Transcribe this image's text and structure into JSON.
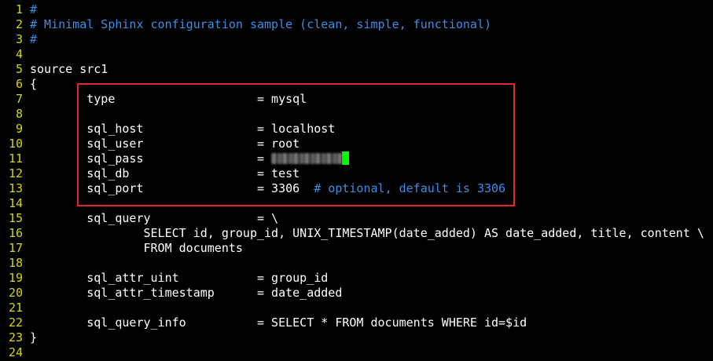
{
  "editor": {
    "lines": [
      {
        "n": "1",
        "text": "#",
        "comment": true
      },
      {
        "n": "2",
        "text": "# Minimal Sphinx configuration sample (clean, simple, functional)",
        "comment": true
      },
      {
        "n": "3",
        "text": "#",
        "comment": true
      },
      {
        "n": "4",
        "text": ""
      },
      {
        "n": "5",
        "text": "source src1"
      },
      {
        "n": "6",
        "text": "{"
      },
      {
        "n": "7",
        "text": "        type                    = mysql"
      },
      {
        "n": "8",
        "text": ""
      },
      {
        "n": "9",
        "text": "        sql_host                = localhost"
      },
      {
        "n": "10",
        "text": "        sql_user                = root"
      },
      {
        "n": "11",
        "text": "        sql_pass                = ",
        "masked": true
      },
      {
        "n": "12",
        "text": "        sql_db                  = test"
      },
      {
        "n": "13",
        "text": "        sql_port                = 3306",
        "trailing_comment": "  # optional, default is 3306"
      },
      {
        "n": "14",
        "text": ""
      },
      {
        "n": "15",
        "text": "        sql_query               = \\"
      },
      {
        "n": "16",
        "text": "                SELECT id, group_id, UNIX_TIMESTAMP(date_added) AS date_added, title, content \\"
      },
      {
        "n": "17",
        "text": "                FROM documents"
      },
      {
        "n": "18",
        "text": ""
      },
      {
        "n": "19",
        "text": "        sql_attr_uint           = group_id"
      },
      {
        "n": "20",
        "text": "        sql_attr_timestamp      = date_added"
      },
      {
        "n": "21",
        "text": ""
      },
      {
        "n": "22",
        "text": "        sql_query_info          = SELECT * FROM documents WHERE id=$id"
      },
      {
        "n": "23",
        "text": "}"
      },
      {
        "n": "24",
        "text": ""
      }
    ]
  },
  "colors": {
    "background": "#000000",
    "line_number": "#d7d700",
    "text": "#ffffff",
    "comment": "#3a8ee6",
    "cursor": "#00ff00",
    "highlight_border": "#e0282e"
  }
}
